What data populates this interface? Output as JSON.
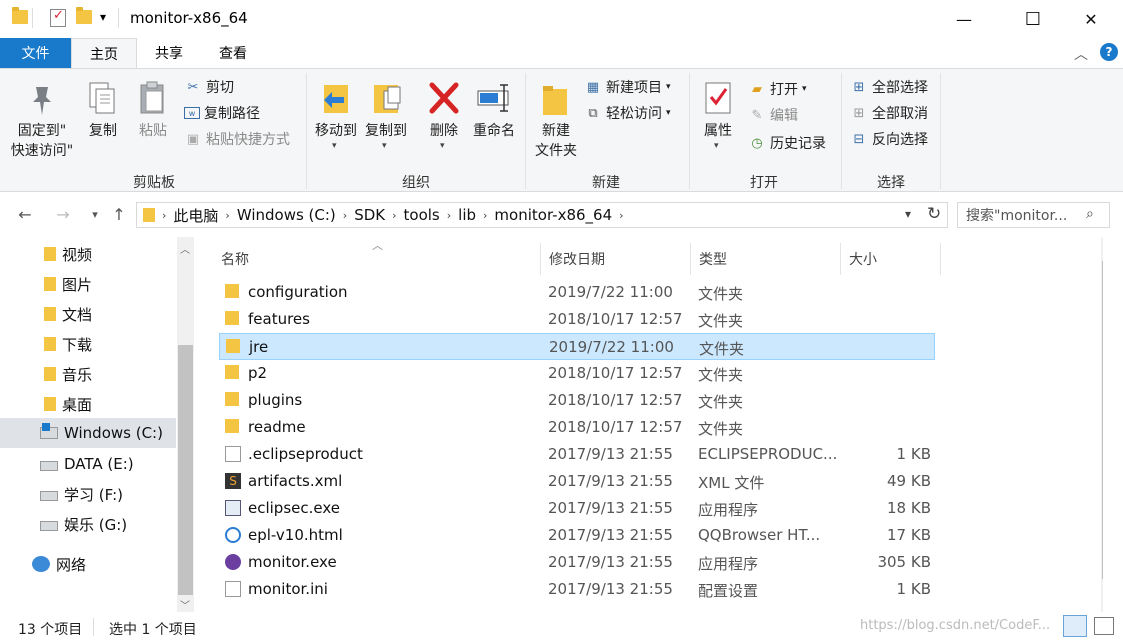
{
  "window": {
    "title": "monitor-x86_64",
    "qa_dropdown": "▾",
    "minimize": "—",
    "maximize": "☐",
    "close": "✕"
  },
  "tabs": [
    {
      "label": "文件"
    },
    {
      "label": "主页"
    },
    {
      "label": "共享"
    },
    {
      "label": "查看"
    }
  ],
  "ribbon": {
    "clipboard": {
      "pin_line1": "固定到\"",
      "pin_line2": "快速访问\"",
      "copy": "复制",
      "paste": "粘贴",
      "cut": "剪切",
      "copy_path": "复制路径",
      "paste_shortcut": "粘贴快捷方式",
      "group": "剪贴板"
    },
    "organize": {
      "move_to": "移动到",
      "copy_to": "复制到",
      "delete": "删除",
      "rename": "重命名",
      "group": "组织"
    },
    "new": {
      "new_folder_line1": "新建",
      "new_folder_line2": "文件夹",
      "new_item": "新建项目",
      "easy_access": "轻松访问",
      "group": "新建"
    },
    "open": {
      "properties": "属性",
      "open": "打开",
      "edit": "编辑",
      "history": "历史记录",
      "group": "打开"
    },
    "select": {
      "select_all": "全部选择",
      "select_none": "全部取消",
      "invert": "反向选择",
      "group": "选择"
    }
  },
  "address": {
    "breadcrumbs": [
      "此电脑",
      "Windows (C:)",
      "SDK",
      "tools",
      "lib",
      "monitor-x86_64"
    ],
    "search_placeholder": "搜索\"monitor..."
  },
  "nav": {
    "items": [
      {
        "label": "视频"
      },
      {
        "label": "图片"
      },
      {
        "label": "文档"
      },
      {
        "label": "下载"
      },
      {
        "label": "音乐"
      },
      {
        "label": "桌面"
      },
      {
        "label": "Windows (C:)"
      },
      {
        "label": "DATA (E:)"
      },
      {
        "label": "学习 (F:)"
      },
      {
        "label": "娱乐 (G:)"
      },
      {
        "label": "网络"
      }
    ]
  },
  "columns": {
    "name": "名称",
    "date": "修改日期",
    "type": "类型",
    "size": "大小"
  },
  "files": [
    {
      "name": "configuration",
      "date": "2019/7/22 11:00",
      "type": "文件夹",
      "size": ""
    },
    {
      "name": "features",
      "date": "2018/10/17 12:57",
      "type": "文件夹",
      "size": ""
    },
    {
      "name": "jre",
      "date": "2019/7/22 11:00",
      "type": "文件夹",
      "size": ""
    },
    {
      "name": "p2",
      "date": "2018/10/17 12:57",
      "type": "文件夹",
      "size": ""
    },
    {
      "name": "plugins",
      "date": "2018/10/17 12:57",
      "type": "文件夹",
      "size": ""
    },
    {
      "name": "readme",
      "date": "2018/10/17 12:57",
      "type": "文件夹",
      "size": ""
    },
    {
      "name": ".eclipseproduct",
      "date": "2017/9/13 21:55",
      "type": "ECLIPSEPRODUC...",
      "size": "1 KB"
    },
    {
      "name": "artifacts.xml",
      "date": "2017/9/13 21:55",
      "type": "XML 文件",
      "size": "49 KB"
    },
    {
      "name": "eclipsec.exe",
      "date": "2017/9/13 21:55",
      "type": "应用程序",
      "size": "18 KB"
    },
    {
      "name": "epl-v10.html",
      "date": "2017/9/13 21:55",
      "type": "QQBrowser HT...",
      "size": "17 KB"
    },
    {
      "name": "monitor.exe",
      "date": "2017/9/13 21:55",
      "type": "应用程序",
      "size": "305 KB"
    },
    {
      "name": "monitor.ini",
      "date": "2017/9/13 21:55",
      "type": "配置设置",
      "size": "1 KB"
    }
  ],
  "status": {
    "count": "13 个项目",
    "selected": "选中 1 个项目",
    "watermark": "https://blog.csdn.net/CodeF..."
  },
  "colors": {
    "accent": "#1979ca",
    "selection": "#cce8ff",
    "folder": "#f4c542"
  }
}
